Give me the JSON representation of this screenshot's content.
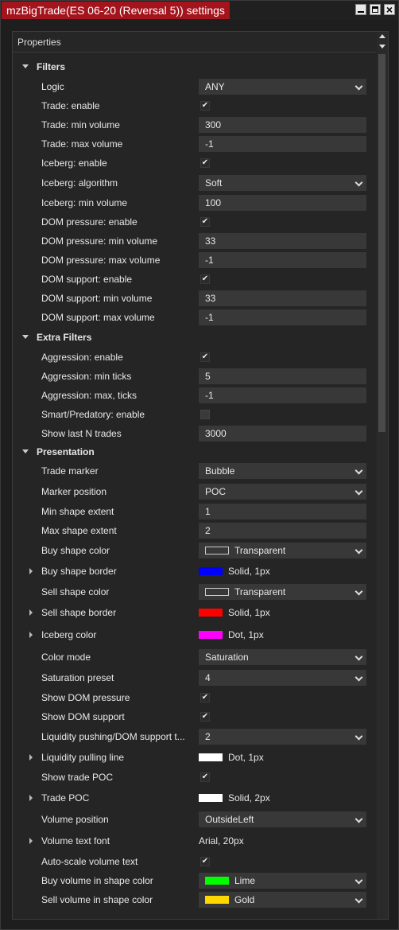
{
  "window": {
    "title": "mzBigTrade(ES 06-20 (Reversal 5)) settings"
  },
  "props_header": "Properties",
  "categories": {
    "filters": "Filters",
    "extra": "Extra Filters",
    "presentation": "Presentation"
  },
  "filters": {
    "logic": {
      "label": "Logic",
      "value": "ANY"
    },
    "trade_enable": {
      "label": "Trade: enable",
      "checked": true
    },
    "trade_min": {
      "label": "Trade: min volume",
      "value": "300"
    },
    "trade_max": {
      "label": "Trade: max volume",
      "value": "-1"
    },
    "iceberg_enable": {
      "label": "Iceberg: enable",
      "checked": true
    },
    "iceberg_alg": {
      "label": "Iceberg: algorithm",
      "value": "Soft"
    },
    "iceberg_min": {
      "label": "Iceberg: min volume",
      "value": "100"
    },
    "dom_pressure_enable": {
      "label": "DOM pressure: enable",
      "checked": true
    },
    "dom_pressure_min": {
      "label": "DOM pressure: min volume",
      "value": "33"
    },
    "dom_pressure_max": {
      "label": "DOM pressure: max volume",
      "value": "-1"
    },
    "dom_support_enable": {
      "label": "DOM support: enable",
      "checked": true
    },
    "dom_support_min": {
      "label": "DOM support: min volume",
      "value": "33"
    },
    "dom_support_max": {
      "label": "DOM support: max volume",
      "value": "-1"
    }
  },
  "extra": {
    "aggr_enable": {
      "label": "Aggression: enable",
      "checked": true
    },
    "aggr_min": {
      "label": "Aggression: min ticks",
      "value": "5"
    },
    "aggr_max": {
      "label": "Aggression: max, ticks",
      "value": "-1"
    },
    "smart_enable": {
      "label": "Smart/Predatory: enable",
      "checked": false
    },
    "show_last": {
      "label": "Show last N trades",
      "value": "3000"
    }
  },
  "presentation": {
    "trade_marker": {
      "label": "Trade marker",
      "value": "Bubble"
    },
    "marker_pos": {
      "label": "Marker position",
      "value": "POC"
    },
    "min_extent": {
      "label": "Min shape extent",
      "value": "1"
    },
    "max_extent": {
      "label": "Max shape extent",
      "value": "2"
    },
    "buy_color": {
      "label": "Buy shape color",
      "value": "Transparent",
      "swatch": "transparent"
    },
    "buy_border": {
      "label": "Buy shape border",
      "value": "Solid, 1px",
      "swatch": "#0000ff"
    },
    "sell_color": {
      "label": "Sell shape color",
      "value": "Transparent",
      "swatch": "transparent"
    },
    "sell_border": {
      "label": "Sell shape border",
      "value": "Solid, 1px",
      "swatch": "#ff0000"
    },
    "iceberg_color": {
      "label": "Iceberg color",
      "value": "Dot, 1px",
      "swatch": "#ff00ff"
    },
    "color_mode": {
      "label": "Color mode",
      "value": "Saturation"
    },
    "sat_preset": {
      "label": "Saturation preset",
      "value": "4"
    },
    "show_dom_pressure": {
      "label": "Show DOM pressure",
      "checked": true
    },
    "show_dom_support": {
      "label": "Show DOM support",
      "checked": true
    },
    "liq_push": {
      "label": "Liquidity pushing/DOM support t...",
      "value": "2"
    },
    "liq_pull": {
      "label": "Liquidity pulling line",
      "value": "Dot, 1px",
      "swatch": "#ffffff"
    },
    "show_trade_poc": {
      "label": "Show trade POC",
      "checked": true
    },
    "trade_poc": {
      "label": "Trade POC",
      "value": "Solid, 2px",
      "swatch": "#ffffff"
    },
    "vol_pos": {
      "label": "Volume position",
      "value": "OutsideLeft"
    },
    "vol_font": {
      "label": "Volume text font",
      "value": "Arial, 20px"
    },
    "autoscale": {
      "label": "Auto-scale volume text",
      "checked": true
    },
    "buy_vol_color": {
      "label": "Buy volume in shape color",
      "value": "Lime",
      "swatch": "#00ff00"
    },
    "sell_vol_color": {
      "label": "Sell volume in shape color",
      "value": "Gold",
      "swatch": "#ffd700"
    }
  }
}
